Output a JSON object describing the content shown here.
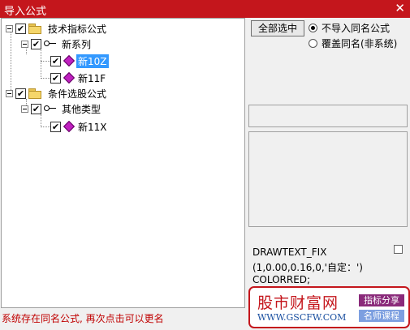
{
  "window": {
    "title": "导入公式",
    "close_glyph": "✕"
  },
  "tree": {
    "group1": {
      "label": "技术指标公式",
      "series": {
        "label": "新系列",
        "items": [
          "新10Z",
          "新11F"
        ]
      }
    },
    "group2": {
      "label": "条件选股公式",
      "series": {
        "label": "其他类型",
        "items": [
          "新11X"
        ]
      }
    },
    "selected_item": "新10Z",
    "check_glyph": "✔"
  },
  "options": {
    "select_all": "全部选中",
    "radio_skip": "不导入同名公式",
    "radio_overwrite": "覆盖同名(非系统)",
    "selected_option": "不导入同名公式"
  },
  "preview": {
    "lines": [
      "DRAWTEXT_FIX",
      "(1,0.00,0.16,0,'自定：')",
      "COLORRED;"
    ]
  },
  "status": "系统存在同名公式, 再次点击可以更名",
  "watermark": {
    "brand": "股市财富网",
    "url": "WWW.GSCFW.COM",
    "tag1": "指标分享",
    "tag2": "名师课程"
  },
  "colors": {
    "title_bar": "#c4161c",
    "status_text": "#c00000",
    "selection": "#3399ff"
  }
}
